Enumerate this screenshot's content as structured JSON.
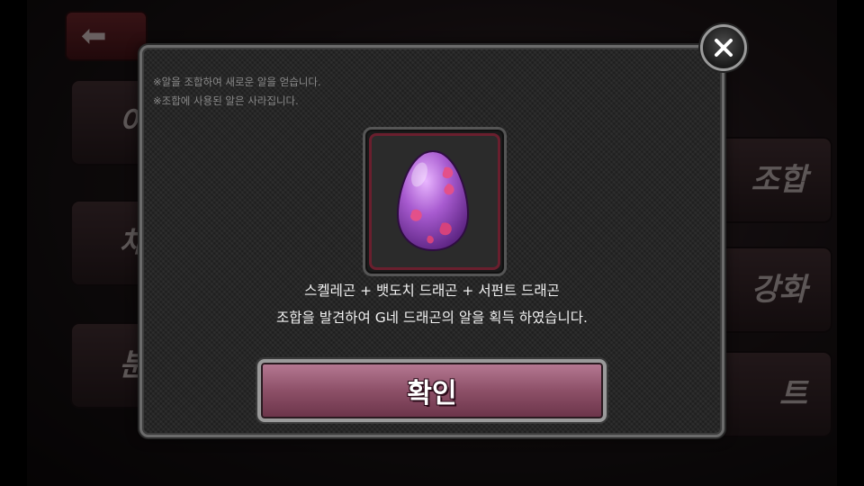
{
  "background": {
    "back_icon": "left-arrow-icon",
    "left_menu": [
      "어",
      "채",
      "분"
    ],
    "right_menu": [
      "조합",
      "강화",
      "트"
    ]
  },
  "dialog": {
    "notes": [
      "※알을 조합하여 새로운 알을 얻습니다.",
      "※조합에 사용된 알은 사라집니다."
    ],
    "close_icon": "close-icon",
    "egg_icon": "purple-dragon-egg-icon",
    "message_line1": "스켈레곤 + 뱃도치 드래곤 + 서펀트 드래곤",
    "message_line2": "조합을 발견하여 G네 드래곤의 알을 획득 하였습니다.",
    "confirm_label": "확인"
  },
  "colors": {
    "confirm_button": "#8d5068",
    "egg": "#9b4fc0",
    "frame_accent": "#6a1f2e"
  }
}
